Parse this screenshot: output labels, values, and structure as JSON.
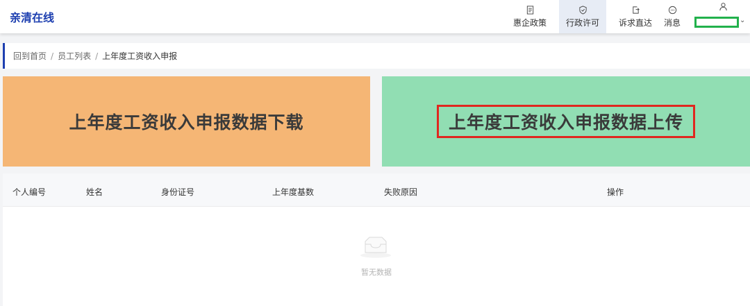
{
  "app": {
    "title": "亲清在线"
  },
  "nav": {
    "items": [
      {
        "label": "惠企政策",
        "icon": "document-icon"
      },
      {
        "label": "行政许可",
        "icon": "shield-icon"
      },
      {
        "label": "诉求直达",
        "icon": "exit-icon"
      },
      {
        "label": "消息",
        "icon": "message-icon"
      }
    ],
    "user": {
      "icon": "user-icon",
      "caret": "⌄"
    }
  },
  "breadcrumb": {
    "items": [
      "回到首页",
      "员工列表",
      "上年度工资收入申报"
    ],
    "separator": "/"
  },
  "cards": {
    "download": {
      "label": "上年度工资收入申报数据下载",
      "color": "#f5b675"
    },
    "upload": {
      "label": "上年度工资收入申报数据上传",
      "color": "#91deb3"
    }
  },
  "table": {
    "columns": [
      "个人编号",
      "姓名",
      "身份证号",
      "上年度基数",
      "失败原因",
      "操作"
    ],
    "rows": [],
    "empty_text": "暂无数据"
  },
  "colors": {
    "brand": "#1d3fb0",
    "highlight_red": "#e0271f",
    "highlight_green": "#22b14c"
  }
}
